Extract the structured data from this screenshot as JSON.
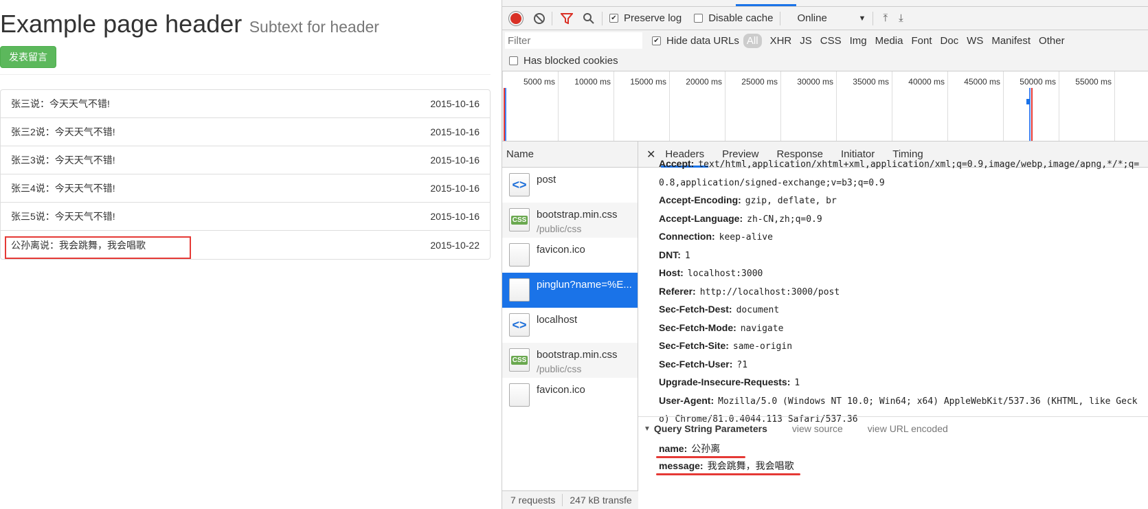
{
  "page": {
    "header_title": "Example page header",
    "header_subtext": "Subtext for header",
    "post_button": "发表留言",
    "comments": [
      {
        "text": "张三说：今天天气不错!",
        "date": "2015-10-16"
      },
      {
        "text": "张三2说：今天天气不错!",
        "date": "2015-10-16"
      },
      {
        "text": "张三3说：今天天气不错!",
        "date": "2015-10-16"
      },
      {
        "text": "张三4说：今天天气不错!",
        "date": "2015-10-16"
      },
      {
        "text": "张三5说：今天天气不错!",
        "date": "2015-10-16"
      },
      {
        "text": "公孙离说：我会跳舞，我会唱歌",
        "date": "2015-10-22"
      }
    ]
  },
  "devtools": {
    "toolbar": {
      "preserve_log": "Preserve log",
      "disable_cache": "Disable cache",
      "throttle": "Online"
    },
    "filter": {
      "placeholder": "Filter",
      "hide_data_urls": "Hide data URLs",
      "types": [
        "All",
        "XHR",
        "JS",
        "CSS",
        "Img",
        "Media",
        "Font",
        "Doc",
        "WS",
        "Manifest",
        "Other"
      ],
      "blocked_cookies": "Has blocked cookies"
    },
    "timeline_ticks": [
      "5000 ms",
      "10000 ms",
      "15000 ms",
      "20000 ms",
      "25000 ms",
      "30000 ms",
      "35000 ms",
      "40000 ms",
      "45000 ms",
      "50000 ms",
      "55000 ms"
    ],
    "name_header": "Name",
    "requests": [
      {
        "name": "post",
        "sub": "",
        "icon": "doc"
      },
      {
        "name": "bootstrap.min.css",
        "sub": "/public/css",
        "icon": "css"
      },
      {
        "name": "favicon.ico",
        "sub": "",
        "icon": "blank"
      },
      {
        "name": "pinglun?name=%E...",
        "sub": "",
        "icon": "blank"
      },
      {
        "name": "localhost",
        "sub": "",
        "icon": "doc"
      },
      {
        "name": "bootstrap.min.css",
        "sub": "/public/css",
        "icon": "css"
      },
      {
        "name": "favicon.ico",
        "sub": "",
        "icon": "blank"
      }
    ],
    "status": {
      "requests": "7 requests",
      "transferred": "247 kB transfe"
    },
    "detail_tabs": [
      "Headers",
      "Preview",
      "Response",
      "Initiator",
      "Timing"
    ],
    "headers": [
      {
        "k": "Accept:",
        "v": "text/html,application/xhtml+xml,application/xml;q=0.9,image/webp,image/apng,*/*;q=0.8,application/signed-exchange;v=b3;q=0.9"
      },
      {
        "k": "Accept-Encoding:",
        "v": "gzip, deflate, br"
      },
      {
        "k": "Accept-Language:",
        "v": "zh-CN,zh;q=0.9"
      },
      {
        "k": "Connection:",
        "v": "keep-alive"
      },
      {
        "k": "DNT:",
        "v": "1"
      },
      {
        "k": "Host:",
        "v": "localhost:3000"
      },
      {
        "k": "Referer:",
        "v": "http://localhost:3000/post"
      },
      {
        "k": "Sec-Fetch-Dest:",
        "v": "document"
      },
      {
        "k": "Sec-Fetch-Mode:",
        "v": "navigate"
      },
      {
        "k": "Sec-Fetch-Site:",
        "v": "same-origin"
      },
      {
        "k": "Sec-Fetch-User:",
        "v": "?1"
      },
      {
        "k": "Upgrade-Insecure-Requests:",
        "v": "1"
      },
      {
        "k": "User-Agent:",
        "v": "Mozilla/5.0 (Windows NT 10.0; Win64; x64) AppleWebKit/537.36 (KHTML, like Gecko) Chrome/81.0.4044.113 Safari/537.36"
      }
    ],
    "query": {
      "title": "Query String Parameters",
      "view_source": "view source",
      "view_url_encoded": "view URL encoded",
      "params": [
        {
          "k": "name:",
          "v": "公孙离"
        },
        {
          "k": "message:",
          "v": "我会跳舞，我会唱歌"
        }
      ]
    },
    "colors": {
      "accent": "#1a73e8",
      "annotation": "#e53935",
      "success_button": "#5cb85c"
    }
  }
}
